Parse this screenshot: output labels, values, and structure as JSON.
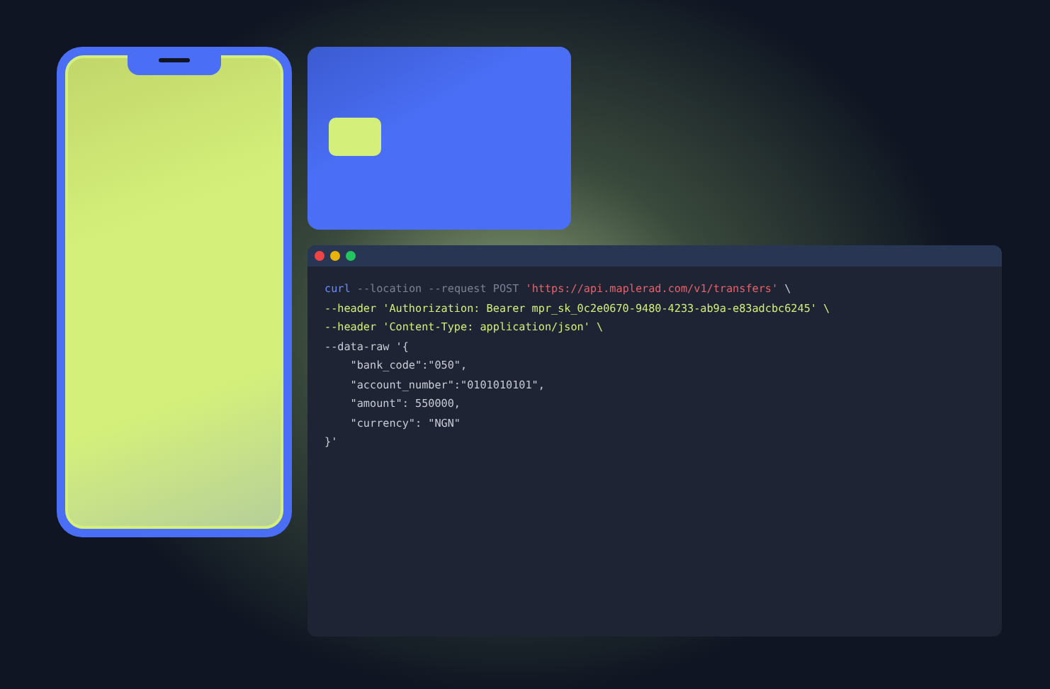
{
  "terminal": {
    "window_controls": [
      {
        "color": "#ef4444"
      },
      {
        "color": "#eab308"
      },
      {
        "color": "#22c55e"
      }
    ],
    "lines": [
      {
        "tokens": [
          {
            "kind": "command",
            "text": "curl"
          },
          {
            "kind": "option",
            "text": " --location --request POST "
          },
          {
            "kind": "url",
            "text": "'https://api.maplerad.com/v1/transfers'"
          },
          {
            "kind": "plain",
            "text": " \\"
          }
        ]
      },
      {
        "tokens": [
          {
            "kind": "header",
            "text": "--header 'Authorization: Bearer mpr_sk_0c2e0670-9480-4233-ab9a-e83adcbc6245' \\"
          }
        ]
      },
      {
        "tokens": [
          {
            "kind": "header",
            "text": "--header 'Content-Type: application/json' \\"
          }
        ]
      },
      {
        "tokens": [
          {
            "kind": "plain",
            "text": "--data-raw '{"
          }
        ]
      },
      {
        "tokens": [
          {
            "kind": "plain",
            "text": "    \"bank_code\":\"050\","
          }
        ]
      },
      {
        "tokens": [
          {
            "kind": "plain",
            "text": "    \"account_number\":\"0101010101\","
          }
        ]
      },
      {
        "tokens": [
          {
            "kind": "plain",
            "text": "    \"amount\": 550000,"
          }
        ]
      },
      {
        "tokens": [
          {
            "kind": "plain",
            "text": "    \"currency\": \"NGN\""
          }
        ]
      },
      {
        "tokens": [
          {
            "kind": "plain",
            "text": "}'"
          }
        ]
      }
    ]
  }
}
